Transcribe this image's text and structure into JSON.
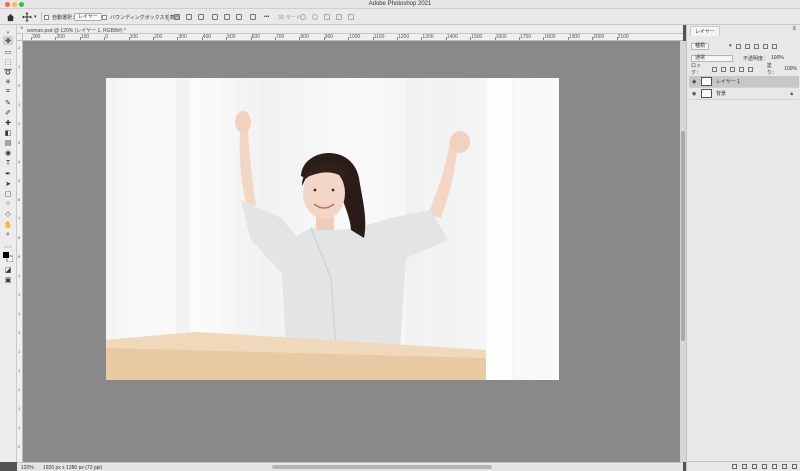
{
  "window": {
    "title": "Adobe Photoshop 2021",
    "traffic_colors": {
      "close": "#fe5f57",
      "minimize": "#febc2e",
      "maximize": "#28c840"
    }
  },
  "options_bar": {
    "auto_select_label": "自動選択：",
    "auto_select_target": "レイヤー",
    "show_transform_label": "バウンディングボックスを表示",
    "more_label": "•••",
    "mode_3d_label": "3D モード："
  },
  "document": {
    "tab_label": "woman.psd @ 120% (レイヤー 1, RGB/8#) *"
  },
  "rulers": {
    "horizontal": [
      "300",
      "200",
      "100",
      "0",
      "100",
      "200",
      "300",
      "400",
      "500",
      "600",
      "700",
      "800",
      "900",
      "1000",
      "1100",
      "1200",
      "1300",
      "1400",
      "1500",
      "1600",
      "1700",
      "1800",
      "1900",
      "2000",
      "2100"
    ],
    "vertical": [
      "2",
      "1",
      "0",
      "1",
      "2",
      "3",
      "4",
      "5",
      "6",
      "7",
      "8",
      "9",
      "1",
      "1",
      "1",
      "1",
      "1",
      "1",
      "1",
      "1",
      "1",
      "2"
    ]
  },
  "status": {
    "zoom": "120%",
    "doc_info": "1920 px x 1280 px (72 ppi)"
  },
  "layers_panel": {
    "tab_label": "レイヤー",
    "filter_kind": "種類",
    "blend_mode": "通常",
    "opacity_label": "不透明度：",
    "opacity_value": "100%",
    "lock_label": "ロック：",
    "fill_label": "塗り：",
    "fill_value": "100%",
    "layers": [
      {
        "name": "レイヤー 1",
        "selected": true
      },
      {
        "name": "背景",
        "selected": false,
        "locked": true
      }
    ]
  }
}
